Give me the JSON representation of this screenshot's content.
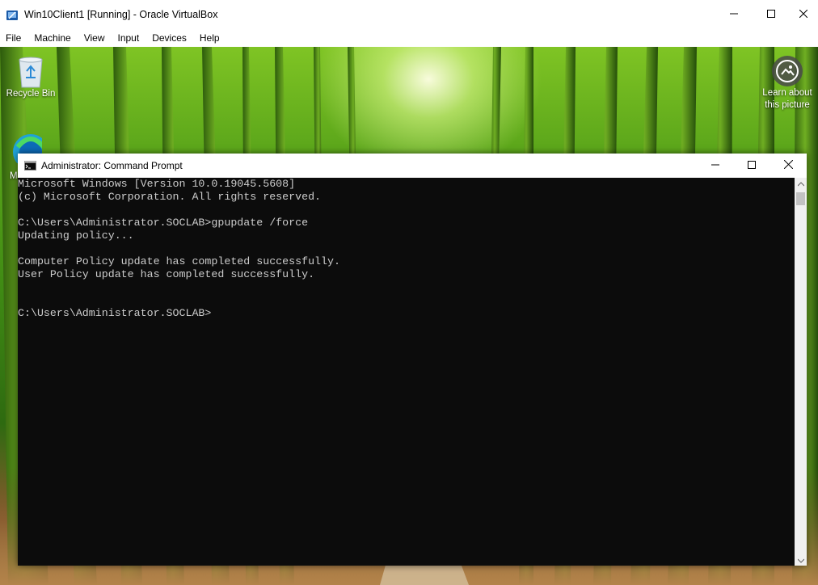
{
  "vbox": {
    "title": "Win10Client1 [Running] - Oracle VirtualBox",
    "app_icon": "virtualbox-icon",
    "controls": {
      "minimize": "minimize-icon",
      "maximize": "maximize-icon",
      "close": "close-icon"
    },
    "menu": [
      "File",
      "Machine",
      "View",
      "Input",
      "Devices",
      "Help"
    ]
  },
  "desktop": {
    "icons": {
      "recycle_bin": {
        "label": "Recycle Bin",
        "icon": "recycle-bin-icon"
      },
      "edge": {
        "label": "M",
        "icon": "edge-icon"
      },
      "spotlight": {
        "label_line1": "Learn about",
        "label_line2": "this picture",
        "icon": "camera-icon"
      }
    }
  },
  "cmd": {
    "title": "Administrator: Command Prompt",
    "icon": "cmd-icon",
    "lines": [
      "Microsoft Windows [Version 10.0.19045.5608]",
      "(c) Microsoft Corporation. All rights reserved.",
      "",
      "C:\\Users\\Administrator.SOCLAB>gpupdate /force",
      "Updating policy...",
      "",
      "Computer Policy update has completed successfully.",
      "User Policy update has completed successfully.",
      "",
      "",
      "C:\\Users\\Administrator.SOCLAB>"
    ]
  },
  "colors": {
    "terminal_bg": "#0c0c0c",
    "terminal_fg": "#cccccc",
    "titlebar_bg": "#ffffff"
  }
}
